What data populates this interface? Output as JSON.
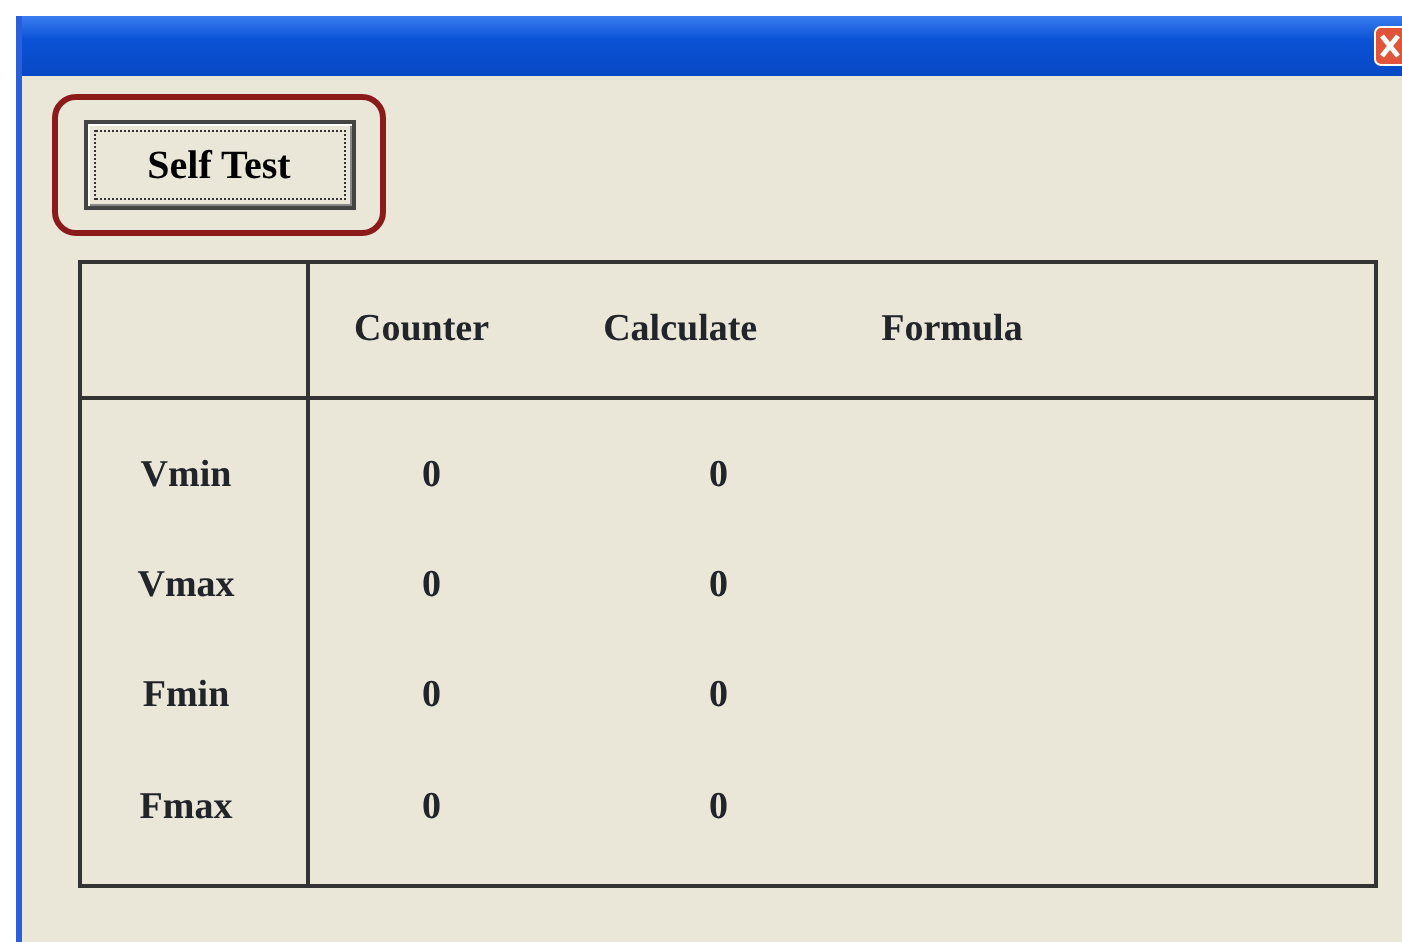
{
  "self_test_button": {
    "label": "Self Test",
    "highlighted": true
  },
  "table": {
    "columns": [
      "Counter",
      "Calculate",
      "Formula"
    ],
    "rows": [
      {
        "label": "Vmin",
        "cells": [
          "0",
          "0"
        ]
      },
      {
        "label": "Vmax",
        "cells": [
          "0",
          "0"
        ]
      },
      {
        "label": "Fmin",
        "cells": [
          "0",
          "0"
        ]
      },
      {
        "label": "Fmax",
        "cells": [
          "0",
          "0"
        ]
      }
    ]
  }
}
